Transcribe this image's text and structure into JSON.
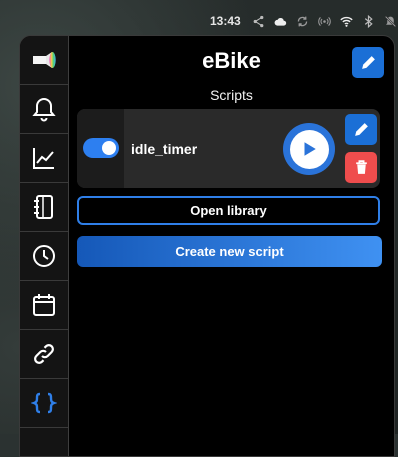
{
  "statusbar": {
    "time": "13:43",
    "icons": [
      "share-icon",
      "cloud-icon",
      "sync-icon",
      "hotspot-icon",
      "wifi-icon",
      "bluetooth-icon",
      "notifications-off-icon"
    ]
  },
  "sidebar": {
    "items": [
      {
        "name": "device-logo",
        "icon": "bike-light-icon",
        "active": false
      },
      {
        "name": "notifications",
        "icon": "bell-icon",
        "active": false
      },
      {
        "name": "charts",
        "icon": "chart-line-icon",
        "active": false
      },
      {
        "name": "notebook",
        "icon": "notebook-icon",
        "active": false
      },
      {
        "name": "history",
        "icon": "clock-icon",
        "active": false
      },
      {
        "name": "calendar",
        "icon": "calendar-icon",
        "active": false
      },
      {
        "name": "links",
        "icon": "link-icon",
        "active": false
      },
      {
        "name": "scripts",
        "icon": "braces-icon",
        "active": true
      }
    ]
  },
  "header": {
    "title": "eBike",
    "subtitle": "Scripts"
  },
  "scripts": [
    {
      "name": "idle_timer",
      "enabled": true
    }
  ],
  "buttons": {
    "open_library": "Open library",
    "create_new": "Create new script"
  },
  "colors": {
    "accent": "#2f7fe8",
    "danger": "#ef4d4d",
    "background": "#000000"
  }
}
